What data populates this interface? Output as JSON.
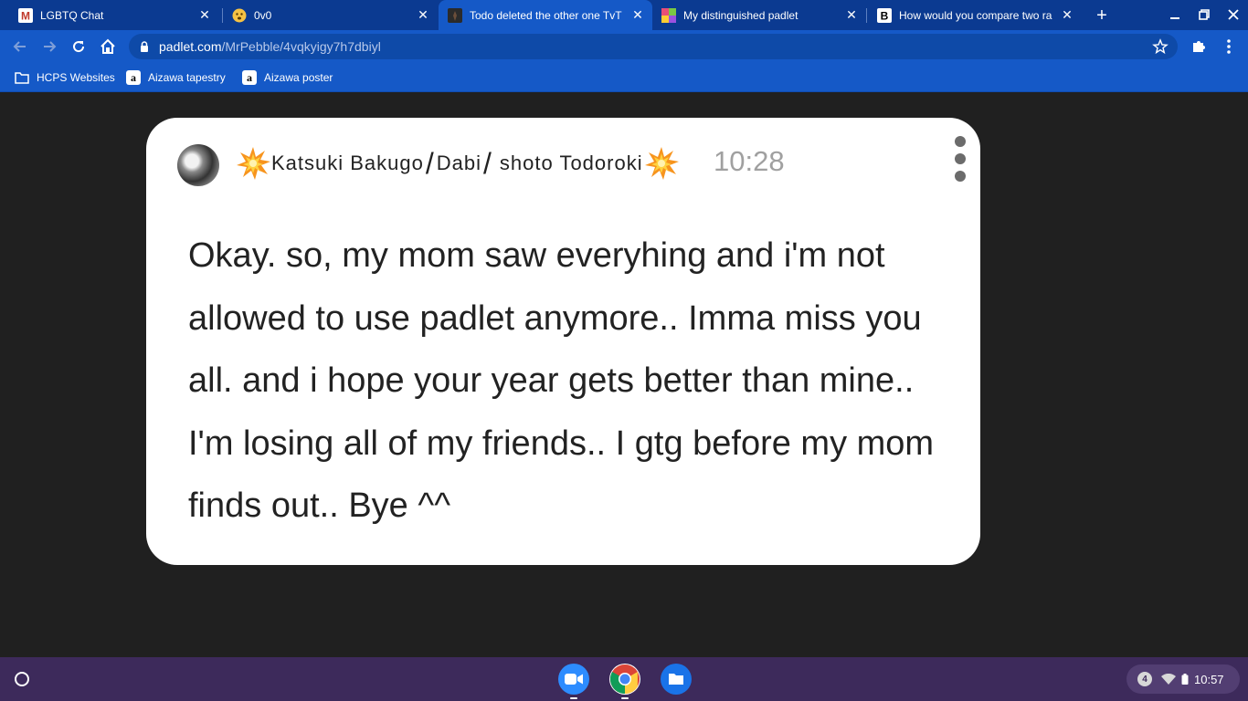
{
  "browser": {
    "tabs": [
      {
        "title": "LGBTQ Chat",
        "favicon": "m-logo-icon",
        "active": false
      },
      {
        "title": "0v0",
        "favicon": "emoji-face-icon",
        "active": false
      },
      {
        "title": "Todo deleted the other one TvT",
        "favicon": "padlet-dark-icon",
        "active": true
      },
      {
        "title": "My distinguished padlet",
        "favicon": "padlet-color-icon",
        "active": false
      },
      {
        "title": "How would you compare two ra",
        "favicon": "b-logo-icon",
        "active": false
      }
    ],
    "url_host": "padlet.com",
    "url_path": "/MrPebble/4vqkyigy7h7dbiyl",
    "bookmarks": [
      {
        "label": "HCPS Websites",
        "icon": "folder-icon"
      },
      {
        "label": "Aizawa tapestry",
        "icon": "amazon-icon"
      },
      {
        "label": "Aizawa poster",
        "icon": "amazon-icon"
      }
    ]
  },
  "post": {
    "author_left": "Katsuki Bakugo",
    "author_mid": "Dabi",
    "author_right": "shoto Todoroki",
    "separator": "/",
    "time": "10:28",
    "body": "Okay. so, my mom saw everyhing and i'm not allowed to use padlet anymore.. Imma miss you all. and i hope your year gets better than mine.. I'm losing all of my friends.. I gtg before my mom finds out.. Bye ^^"
  },
  "shelf": {
    "apps": [
      "zoom-icon",
      "chrome-icon",
      "files-icon"
    ],
    "notification_count": "4",
    "clock": "10:57"
  },
  "colors": {
    "tabstrip": "#0b3a91",
    "toolbar": "#1559c7",
    "page_bg": "#202020",
    "shelf": "#3d2a5b"
  }
}
